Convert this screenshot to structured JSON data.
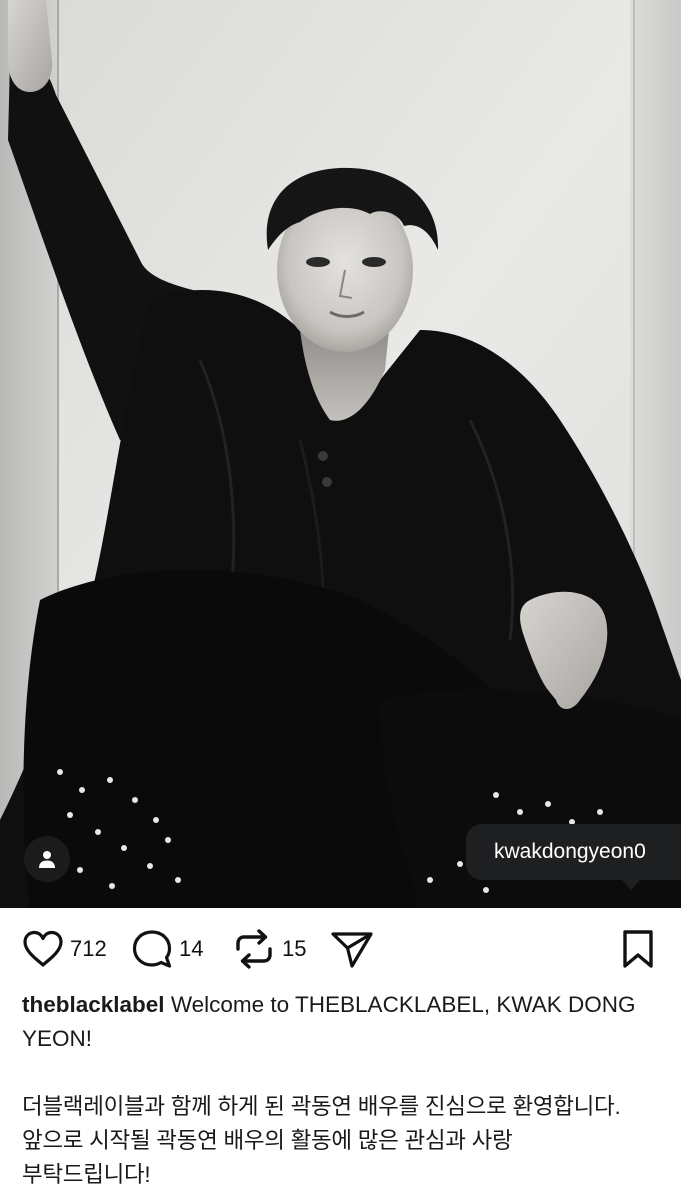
{
  "post": {
    "tagged_user": "kwakdongyeon0",
    "user_tag_icon": "person-icon",
    "likes": "712",
    "comments": "14",
    "reposts": "15",
    "icons": {
      "like": "heart-icon",
      "comment": "comment-bubble-icon",
      "repost": "repost-arrows-icon",
      "share": "paper-plane-icon",
      "save": "bookmark-icon"
    }
  },
  "caption": {
    "username": "theblacklabel",
    "text_en": " Welcome to THEBLACKLABEL, KWAK DONG YEON!",
    "text_kr_line1": "더블랙레이블과 함께 하게 된 곽동연 배우를 진심으로 환영합니다.",
    "text_kr_line2": "앞으로 시작될 곽동연 배우의 활동에 많은 관심과 사랑",
    "text_kr_line3": "부탁드립니다!"
  }
}
